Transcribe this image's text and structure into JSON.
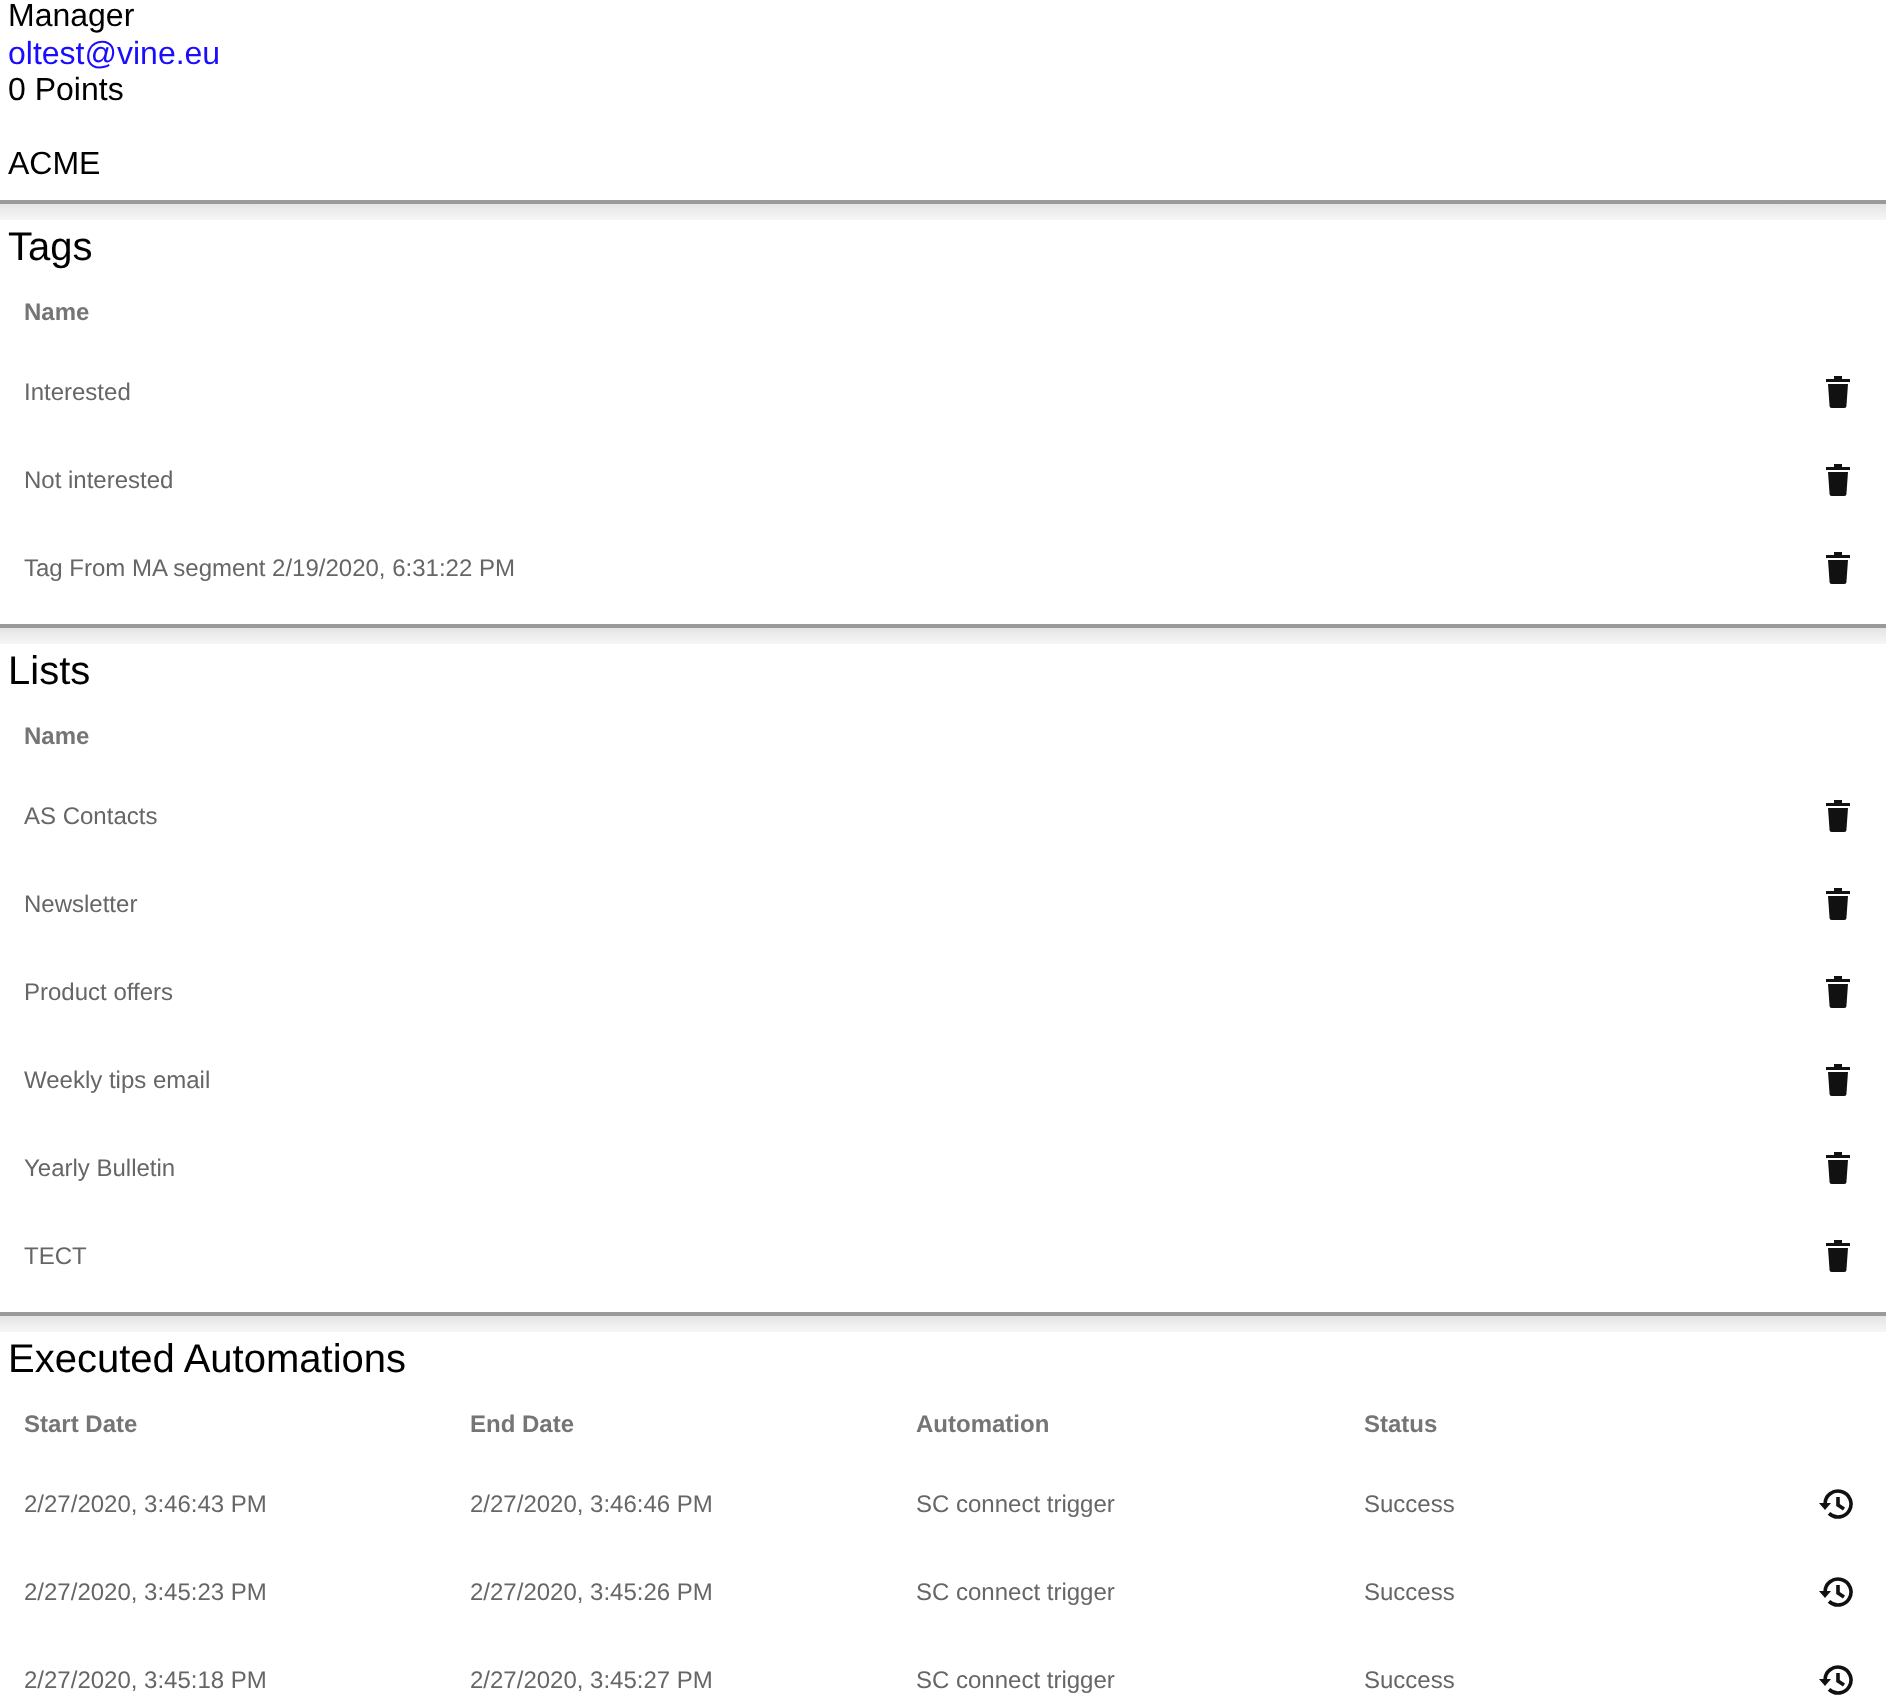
{
  "profile": {
    "role": "Manager",
    "email": "oltest@vine.eu",
    "points": "0 Points",
    "company": "ACME"
  },
  "sections": [
    {
      "title": "Tags",
      "kind": "names",
      "columns": [
        "Name"
      ],
      "rows": [
        {
          "cells": [
            "Interested"
          ]
        },
        {
          "cells": [
            "Not interested"
          ]
        },
        {
          "cells": [
            "Tag From MA segment 2/19/2020, 6:31:22 PM"
          ]
        }
      ]
    },
    {
      "title": "Lists",
      "kind": "names",
      "columns": [
        "Name"
      ],
      "rows": [
        {
          "cells": [
            "AS Contacts"
          ]
        },
        {
          "cells": [
            "Newsletter"
          ]
        },
        {
          "cells": [
            "Product offers"
          ]
        },
        {
          "cells": [
            "Weekly tips email"
          ]
        },
        {
          "cells": [
            "Yearly Bulletin"
          ]
        },
        {
          "cells": [
            "TECT"
          ]
        }
      ]
    },
    {
      "title": "Executed Automations",
      "kind": "automations",
      "columns": [
        "Start Date",
        "End Date",
        "Automation",
        "Status"
      ],
      "rows": [
        {
          "cells": [
            "2/27/2020, 3:46:43 PM",
            "2/27/2020, 3:46:46 PM",
            "SC connect trigger",
            "Success"
          ]
        },
        {
          "cells": [
            "2/27/2020, 3:45:23 PM",
            "2/27/2020, 3:45:26 PM",
            "SC connect trigger",
            "Success"
          ]
        },
        {
          "cells": [
            "2/27/2020, 3:45:18 PM",
            "2/27/2020, 3:45:27 PM",
            "SC connect trigger",
            "Success"
          ]
        }
      ]
    }
  ]
}
